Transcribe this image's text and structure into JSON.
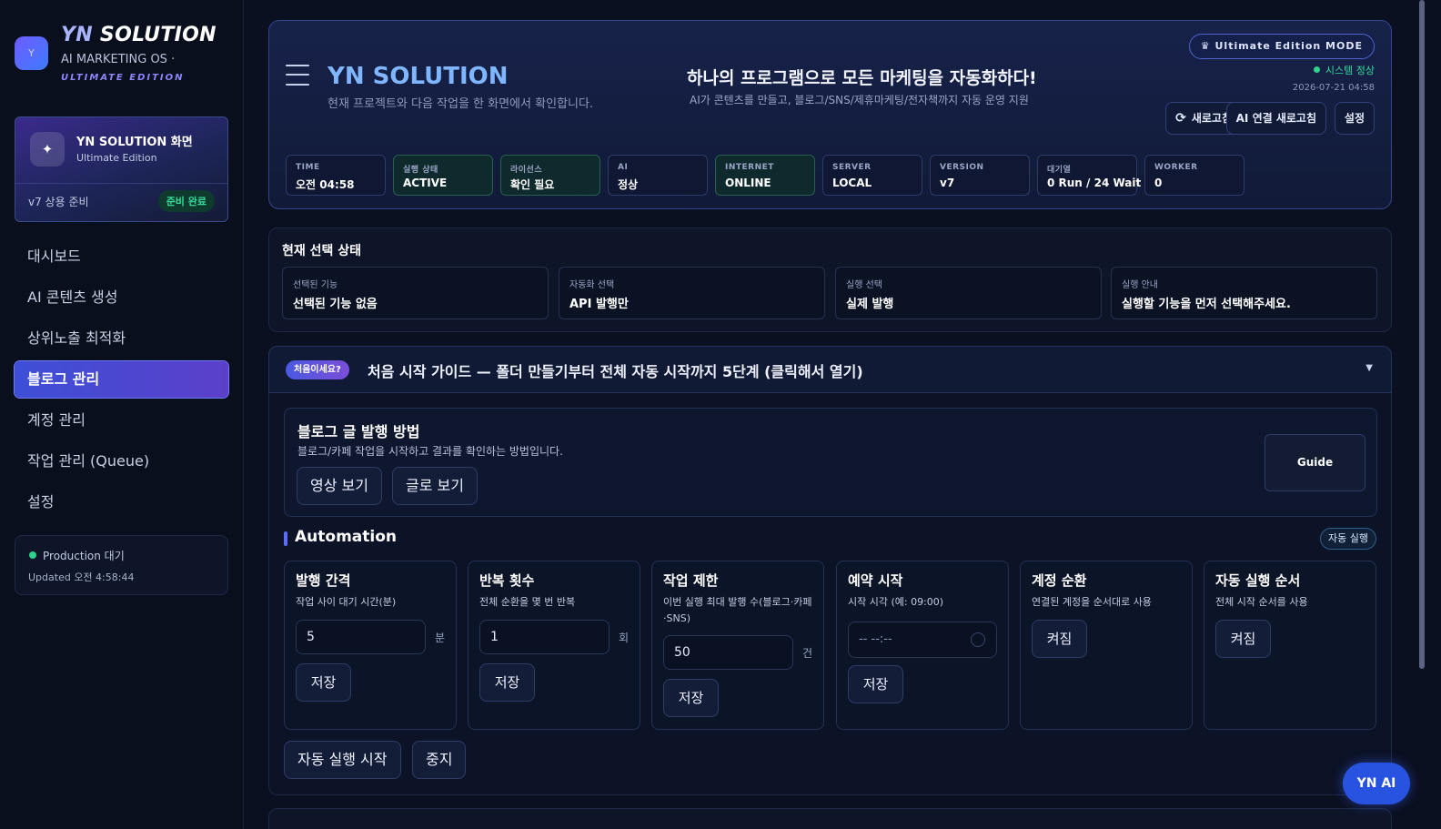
{
  "brand": {
    "logo_letter": "Y",
    "title_prefix": "YN",
    "title_main": "SOLUTION",
    "subtitle": "AI MARKETING OS ·",
    "edition": "ULTIMATE EDITION"
  },
  "screen_card": {
    "title": "YN SOLUTION 화면",
    "subtitle": "Ultimate Edition",
    "version": "v7 상용 준비",
    "badge": "준비 완료"
  },
  "nav": {
    "items": [
      {
        "label": "대시보드"
      },
      {
        "label": "AI 콘텐츠 생성"
      },
      {
        "label": "상위노출 최적화"
      },
      {
        "label": "블로그 관리"
      },
      {
        "label": "계정 관리"
      },
      {
        "label": "작업 관리 (Queue)"
      },
      {
        "label": "설정"
      }
    ],
    "active_index": 3
  },
  "production": {
    "status": "Production 대기",
    "updated": "Updated 오전 4:58:44"
  },
  "header": {
    "title": "YN SOLUTION",
    "subtitle": "현재 프로젝트와 다음 작업을 한 화면에서 확인합니다.",
    "tagline": "하나의 프로그램으로 모든 마케팅을 자동화하다!",
    "tagline_sub": "AI가 콘텐츠를 만들고, 블로그/SNS/제휴마케팅/전자책까지 자동 운영 지원",
    "mode": "♛  Ultimate Edition  MODE",
    "system_status": "시스템 정상",
    "timestamp": "2026-07-21 04:58",
    "buttons": {
      "refresh": "새로고침",
      "ai_refresh": "AI 연결 새로고침",
      "settings": "설정"
    },
    "stats": [
      {
        "key": "TIME",
        "value": "오전 04:58",
        "highlight": false
      },
      {
        "key": "실행 상태",
        "value": "ACTIVE",
        "highlight": true
      },
      {
        "key": "라이선스",
        "value": "확인 필요",
        "highlight": true
      },
      {
        "key": "AI",
        "value": "정상",
        "highlight": false
      },
      {
        "key": "INTERNET",
        "value": "ONLINE",
        "highlight": true
      },
      {
        "key": "SERVER",
        "value": "LOCAL",
        "highlight": false
      },
      {
        "key": "VERSION",
        "value": "v7",
        "highlight": false
      },
      {
        "key": "대기열",
        "value": "0 Run / 24 Wait",
        "highlight": false
      },
      {
        "key": "WORKER",
        "value": "0",
        "highlight": false
      }
    ]
  },
  "selection": {
    "title": "현재 선택 상태",
    "boxes": [
      {
        "key": "선택된 기능",
        "value": "선택된 기능 없음"
      },
      {
        "key": "자동화 선택",
        "value": "API 발행만"
      },
      {
        "key": "실행 선택",
        "value": "실제 발행"
      },
      {
        "key": "실행 안내",
        "value": "실행할 기능을 먼저 선택해주세요."
      }
    ]
  },
  "guide_bar": {
    "badge": "처음이세요?",
    "text": "처음 시작 가이드 — 폴더 만들기부터 전체 자동 시작까지 5단계 (클릭해서 열기)",
    "caret": "▼"
  },
  "blog_method": {
    "title": "블로그 글 발행 방법",
    "subtitle": "블로그/카페 작업을 시작하고 결과를 확인하는 방법입니다.",
    "video_button": "영상 보기",
    "text_button": "글로 보기",
    "guide_button": "Guide"
  },
  "automation": {
    "title": "Automation",
    "badge": "자동 실행",
    "cards": [
      {
        "title": "발행 간격",
        "desc": "작업 사이 대기 시간(분)",
        "value": "5",
        "unit": "분",
        "button": "저장"
      },
      {
        "title": "반복 횟수",
        "desc": "전체 순환을 몇 번 반복",
        "value": "1",
        "unit": "회",
        "button": "저장"
      },
      {
        "title": "작업 제한",
        "desc": "이번 실행 최대 발행 수(블로그·카페·SNS)",
        "value": "50",
        "unit": "건",
        "button": "저장"
      },
      {
        "title": "예약 시작",
        "desc": "시작 시각 (예: 09:00)",
        "placeholder": "-- --:--",
        "button": "저장"
      },
      {
        "title": "계정 순환",
        "desc": "연결된 계정을 순서대로 사용",
        "toggle": "켜짐"
      },
      {
        "title": "자동 실행 순서",
        "desc": "전체 시작 순서를 사용",
        "toggle": "켜짐"
      }
    ],
    "start_button": "자동 실행 시작",
    "stop_button": "중지"
  },
  "fab": {
    "label": "YN AI"
  },
  "colors": {
    "background": "#0b1020",
    "accent": "#5a6dff",
    "title_blue": "#7fb6ff",
    "success": "#2fd28a",
    "fab": "#2853e0"
  }
}
